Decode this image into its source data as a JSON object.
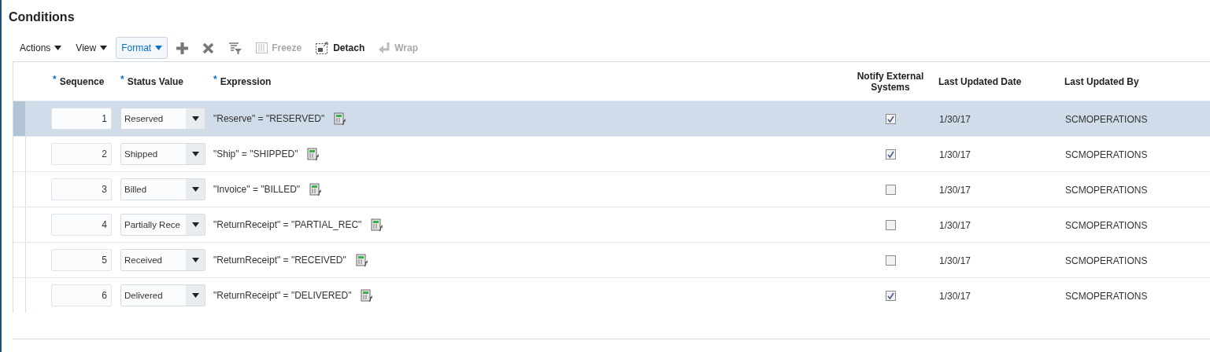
{
  "title": "Conditions",
  "toolbar": [
    {
      "kind": "menu",
      "label": "Actions",
      "active": false
    },
    {
      "kind": "menu",
      "label": "View",
      "active": false
    },
    {
      "kind": "menu",
      "label": "Format",
      "active": true
    },
    {
      "kind": "add",
      "disabled": false
    },
    {
      "kind": "delete",
      "disabled": false
    },
    {
      "kind": "filter",
      "disabled": false
    },
    {
      "kind": "freeze",
      "label": "Freeze",
      "disabled": true
    },
    {
      "kind": "detach",
      "label": "Detach",
      "disabled": false
    },
    {
      "kind": "wrap",
      "label": "Wrap",
      "disabled": true
    }
  ],
  "table": {
    "columns": [
      {
        "label": "Sequence",
        "required_mark": "*"
      },
      {
        "label": "Status Value",
        "required_mark": "*"
      },
      {
        "label": "Expression",
        "required_mark": "*"
      },
      {
        "label": "Notify External Systems"
      },
      {
        "label": "Last Updated Date"
      },
      {
        "label": "Last Updated By"
      }
    ],
    "rows": [
      {
        "selected": true,
        "sequence": "1",
        "status_value": "Reserved",
        "expression": "\"Reserve\" = \"RESERVED\"",
        "notify": true,
        "date": "1/30/17",
        "by": "SCMOPERATIONS"
      },
      {
        "selected": false,
        "sequence": "2",
        "status_value": "Shipped",
        "expression": "\"Ship\" = \"SHIPPED\"",
        "notify": true,
        "date": "1/30/17",
        "by": "SCMOPERATIONS"
      },
      {
        "selected": false,
        "sequence": "3",
        "status_value": "Billed",
        "expression": "\"Invoice\" = \"BILLED\"",
        "notify": false,
        "date": "1/30/17",
        "by": "SCMOPERATIONS"
      },
      {
        "selected": false,
        "sequence": "4",
        "status_value": "Partially Rece",
        "expression": "\"ReturnReceipt\" = \"PARTIAL_REC\"",
        "notify": false,
        "date": "1/30/17",
        "by": "SCMOPERATIONS"
      },
      {
        "selected": false,
        "sequence": "5",
        "status_value": "Received",
        "expression": "\"ReturnReceipt\" = \"RECEIVED\"",
        "notify": false,
        "date": "1/30/17",
        "by": "SCMOPERATIONS"
      },
      {
        "selected": false,
        "sequence": "6",
        "status_value": "Delivered",
        "expression": "\"ReturnReceipt\" = \"DELIVERED\"",
        "notify": true,
        "date": "1/30/17",
        "by": "SCMOPERATIONS"
      }
    ]
  }
}
